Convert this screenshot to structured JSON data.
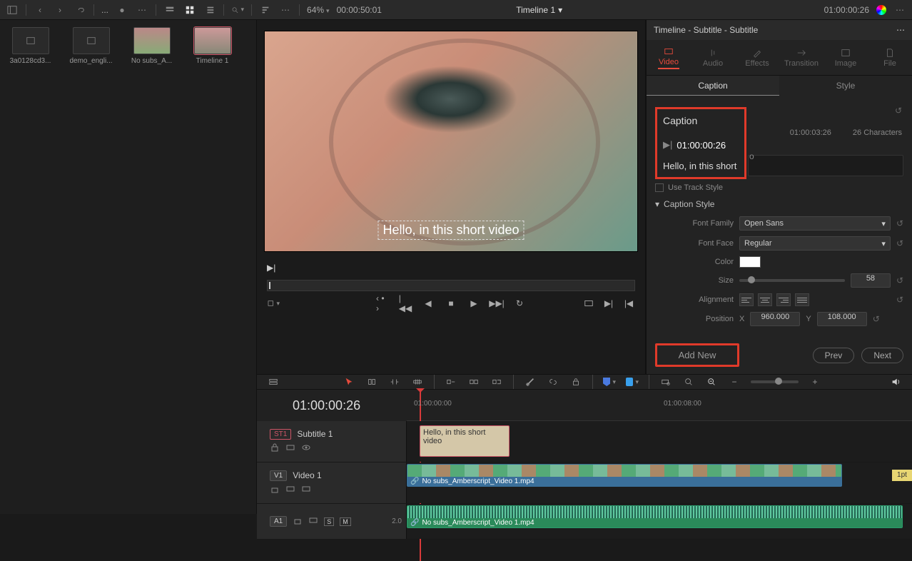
{
  "topbar": {
    "breadcrumb": "...",
    "zoom": "64%",
    "duration": "00:00:50:01",
    "title": "Timeline 1",
    "timecode_right": "01:00:00:26"
  },
  "media_pool": {
    "items": [
      {
        "name": "3a0128cd3..."
      },
      {
        "name": "demo_engli..."
      },
      {
        "name": "No subs_A..."
      },
      {
        "name": "Timeline 1"
      }
    ]
  },
  "viewer": {
    "subtitle_text": "Hello, in this short video"
  },
  "timeline": {
    "timecode": "01:00:00:26",
    "ruler_labels": {
      "t1": "01:00:00:00",
      "t2": "01:00:08:00"
    },
    "tracks": {
      "st1": {
        "badge": "ST1",
        "name": "Subtitle 1",
        "clip_text": "Hello, in this short video"
      },
      "v1": {
        "badge": "V1",
        "name": "Video 1",
        "clip_name": "No subs_Amberscript_Video 1.mp4",
        "tag": "1pt"
      },
      "a1": {
        "badge": "A1",
        "sm_s": "S",
        "sm_m": "M",
        "level": "2.0",
        "clip_name": "No subs_Amberscript_Video 1.mp4"
      }
    }
  },
  "inspector": {
    "title": "Timeline - Subtitle - Subtitle",
    "tabs": {
      "video": "Video",
      "audio": "Audio",
      "effects": "Effects",
      "transition": "Transition",
      "image": "Image",
      "file": "File"
    },
    "subtabs": {
      "caption": "Caption",
      "style": "Style"
    },
    "caption": {
      "heading": "Caption",
      "in_tc": "01:00:00:26",
      "out_tc": "01:00:03:26",
      "char_count": "26 Characters",
      "to_label": "o",
      "text_preview": "Hello, in this short",
      "use_track_style": "Use Track Style"
    },
    "style": {
      "heading": "Caption Style",
      "labels": {
        "font_family": "Font Family",
        "font_face": "Font Face",
        "color": "Color",
        "size": "Size",
        "alignment": "Alignment",
        "position": "Position",
        "x": "X",
        "y": "Y"
      },
      "font_family": "Open Sans",
      "font_face": "Regular",
      "size": "58",
      "pos_x": "960.000",
      "pos_y": "108.000"
    },
    "nav": {
      "add_new": "Add New",
      "prev": "Prev",
      "next": "Next"
    }
  }
}
